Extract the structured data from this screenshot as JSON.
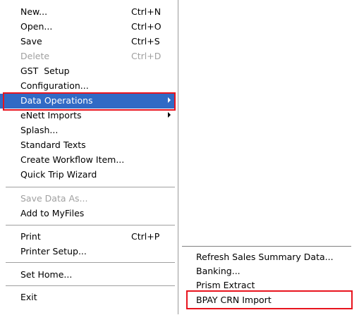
{
  "file_menu": {
    "items": [
      {
        "label": "New...",
        "shortcut": "Ctrl+N"
      },
      {
        "label": "Open...",
        "shortcut": "Ctrl+O"
      },
      {
        "label": "Save",
        "shortcut": "Ctrl+S"
      },
      {
        "label": "Delete",
        "shortcut": "Ctrl+D"
      },
      {
        "label": "GST  Setup"
      },
      {
        "label": "Configuration..."
      },
      {
        "label": "Data Operations"
      },
      {
        "label": "eNett Imports"
      },
      {
        "label": "Splash..."
      },
      {
        "label": "Standard Texts"
      },
      {
        "label": "Create Workflow Item..."
      },
      {
        "label": "Quick Trip Wizard"
      },
      {
        "label": "Save Data As..."
      },
      {
        "label": "Add to MyFiles"
      },
      {
        "label": "Print",
        "shortcut": "Ctrl+P"
      },
      {
        "label": "Printer Setup..."
      },
      {
        "label": "Set Home..."
      },
      {
        "label": "Exit"
      }
    ]
  },
  "data_operations_submenu": {
    "items": [
      {
        "label": "Refresh Sales Summary Data..."
      },
      {
        "label": "Banking..."
      },
      {
        "label": "Prism Extract"
      },
      {
        "label": "BPAY CRN Import"
      }
    ]
  },
  "colors": {
    "highlight_bg": "#316ac5",
    "callout_border": "#e8141e",
    "disabled_text": "#a0a0a0"
  }
}
